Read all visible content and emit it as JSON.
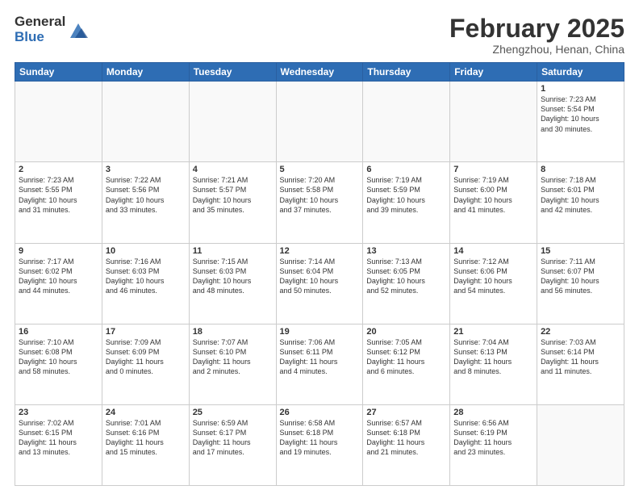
{
  "header": {
    "logo_general": "General",
    "logo_blue": "Blue",
    "month_title": "February 2025",
    "location": "Zhengzhou, Henan, China"
  },
  "days_of_week": [
    "Sunday",
    "Monday",
    "Tuesday",
    "Wednesday",
    "Thursday",
    "Friday",
    "Saturday"
  ],
  "weeks": [
    [
      {
        "num": "",
        "info": ""
      },
      {
        "num": "",
        "info": ""
      },
      {
        "num": "",
        "info": ""
      },
      {
        "num": "",
        "info": ""
      },
      {
        "num": "",
        "info": ""
      },
      {
        "num": "",
        "info": ""
      },
      {
        "num": "1",
        "info": "Sunrise: 7:23 AM\nSunset: 5:54 PM\nDaylight: 10 hours\nand 30 minutes."
      }
    ],
    [
      {
        "num": "2",
        "info": "Sunrise: 7:23 AM\nSunset: 5:55 PM\nDaylight: 10 hours\nand 31 minutes."
      },
      {
        "num": "3",
        "info": "Sunrise: 7:22 AM\nSunset: 5:56 PM\nDaylight: 10 hours\nand 33 minutes."
      },
      {
        "num": "4",
        "info": "Sunrise: 7:21 AM\nSunset: 5:57 PM\nDaylight: 10 hours\nand 35 minutes."
      },
      {
        "num": "5",
        "info": "Sunrise: 7:20 AM\nSunset: 5:58 PM\nDaylight: 10 hours\nand 37 minutes."
      },
      {
        "num": "6",
        "info": "Sunrise: 7:19 AM\nSunset: 5:59 PM\nDaylight: 10 hours\nand 39 minutes."
      },
      {
        "num": "7",
        "info": "Sunrise: 7:19 AM\nSunset: 6:00 PM\nDaylight: 10 hours\nand 41 minutes."
      },
      {
        "num": "8",
        "info": "Sunrise: 7:18 AM\nSunset: 6:01 PM\nDaylight: 10 hours\nand 42 minutes."
      }
    ],
    [
      {
        "num": "9",
        "info": "Sunrise: 7:17 AM\nSunset: 6:02 PM\nDaylight: 10 hours\nand 44 minutes."
      },
      {
        "num": "10",
        "info": "Sunrise: 7:16 AM\nSunset: 6:03 PM\nDaylight: 10 hours\nand 46 minutes."
      },
      {
        "num": "11",
        "info": "Sunrise: 7:15 AM\nSunset: 6:03 PM\nDaylight: 10 hours\nand 48 minutes."
      },
      {
        "num": "12",
        "info": "Sunrise: 7:14 AM\nSunset: 6:04 PM\nDaylight: 10 hours\nand 50 minutes."
      },
      {
        "num": "13",
        "info": "Sunrise: 7:13 AM\nSunset: 6:05 PM\nDaylight: 10 hours\nand 52 minutes."
      },
      {
        "num": "14",
        "info": "Sunrise: 7:12 AM\nSunset: 6:06 PM\nDaylight: 10 hours\nand 54 minutes."
      },
      {
        "num": "15",
        "info": "Sunrise: 7:11 AM\nSunset: 6:07 PM\nDaylight: 10 hours\nand 56 minutes."
      }
    ],
    [
      {
        "num": "16",
        "info": "Sunrise: 7:10 AM\nSunset: 6:08 PM\nDaylight: 10 hours\nand 58 minutes."
      },
      {
        "num": "17",
        "info": "Sunrise: 7:09 AM\nSunset: 6:09 PM\nDaylight: 11 hours\nand 0 minutes."
      },
      {
        "num": "18",
        "info": "Sunrise: 7:07 AM\nSunset: 6:10 PM\nDaylight: 11 hours\nand 2 minutes."
      },
      {
        "num": "19",
        "info": "Sunrise: 7:06 AM\nSunset: 6:11 PM\nDaylight: 11 hours\nand 4 minutes."
      },
      {
        "num": "20",
        "info": "Sunrise: 7:05 AM\nSunset: 6:12 PM\nDaylight: 11 hours\nand 6 minutes."
      },
      {
        "num": "21",
        "info": "Sunrise: 7:04 AM\nSunset: 6:13 PM\nDaylight: 11 hours\nand 8 minutes."
      },
      {
        "num": "22",
        "info": "Sunrise: 7:03 AM\nSunset: 6:14 PM\nDaylight: 11 hours\nand 11 minutes."
      }
    ],
    [
      {
        "num": "23",
        "info": "Sunrise: 7:02 AM\nSunset: 6:15 PM\nDaylight: 11 hours\nand 13 minutes."
      },
      {
        "num": "24",
        "info": "Sunrise: 7:01 AM\nSunset: 6:16 PM\nDaylight: 11 hours\nand 15 minutes."
      },
      {
        "num": "25",
        "info": "Sunrise: 6:59 AM\nSunset: 6:17 PM\nDaylight: 11 hours\nand 17 minutes."
      },
      {
        "num": "26",
        "info": "Sunrise: 6:58 AM\nSunset: 6:18 PM\nDaylight: 11 hours\nand 19 minutes."
      },
      {
        "num": "27",
        "info": "Sunrise: 6:57 AM\nSunset: 6:18 PM\nDaylight: 11 hours\nand 21 minutes."
      },
      {
        "num": "28",
        "info": "Sunrise: 6:56 AM\nSunset: 6:19 PM\nDaylight: 11 hours\nand 23 minutes."
      },
      {
        "num": "",
        "info": ""
      }
    ]
  ]
}
